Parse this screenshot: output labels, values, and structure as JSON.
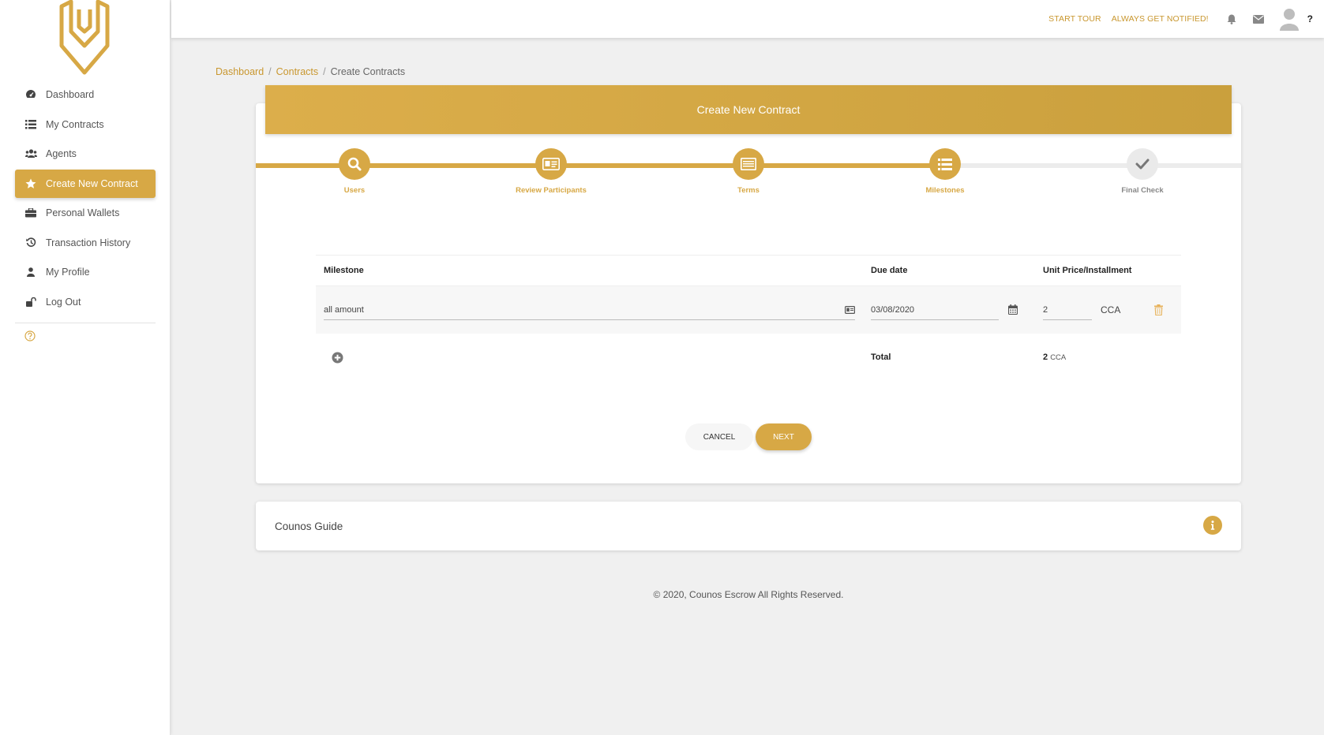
{
  "brand": {
    "accent": "#d7a845",
    "accent_dark": "#c9972f"
  },
  "sidebar": {
    "items": [
      {
        "label": "Dashboard",
        "icon": "dashboard-icon"
      },
      {
        "label": "My Contracts",
        "icon": "list-icon"
      },
      {
        "label": "Agents",
        "icon": "users-icon"
      },
      {
        "label": "Create New Contract",
        "icon": "star-icon",
        "active": true
      },
      {
        "label": "Personal Wallets",
        "icon": "briefcase-icon"
      },
      {
        "label": "Transaction History",
        "icon": "history-icon"
      },
      {
        "label": "My Profile",
        "icon": "user-icon"
      },
      {
        "label": "Log Out",
        "icon": "unlock-icon"
      }
    ]
  },
  "header": {
    "start_tour": "START TOUR",
    "notify": "ALWAYS GET NOTIFIED!",
    "help": "?"
  },
  "breadcrumb": {
    "items": [
      "Dashboard",
      "Contracts",
      "Create Contracts"
    ],
    "separator": "/"
  },
  "card": {
    "title": "Create New Contract",
    "steps": [
      {
        "label": "Users",
        "icon": "search-icon",
        "done": true
      },
      {
        "label": "Review Participants",
        "icon": "id-card-icon",
        "done": true
      },
      {
        "label": "Terms",
        "icon": "document-list-icon",
        "done": true
      },
      {
        "label": "Milestones",
        "icon": "list-icon",
        "done": true
      },
      {
        "label": "Final Check",
        "icon": "check-icon",
        "done": false
      }
    ]
  },
  "table": {
    "headers": {
      "milestone": "Milestone",
      "due": "Due date",
      "price": "Unit Price/Installment"
    },
    "row": {
      "milestone": "all amount",
      "due": "03/08/2020",
      "price": "2",
      "currency": "CCA"
    },
    "footer": {
      "total_label": "Total",
      "total_value": "2",
      "total_currency": "CCA"
    }
  },
  "actions": {
    "cancel": "CANCEL",
    "next": "NEXT"
  },
  "guide": {
    "title": "Counos Guide"
  },
  "footer": {
    "text": "© 2020, Counos Escrow All Rights Reserved."
  }
}
